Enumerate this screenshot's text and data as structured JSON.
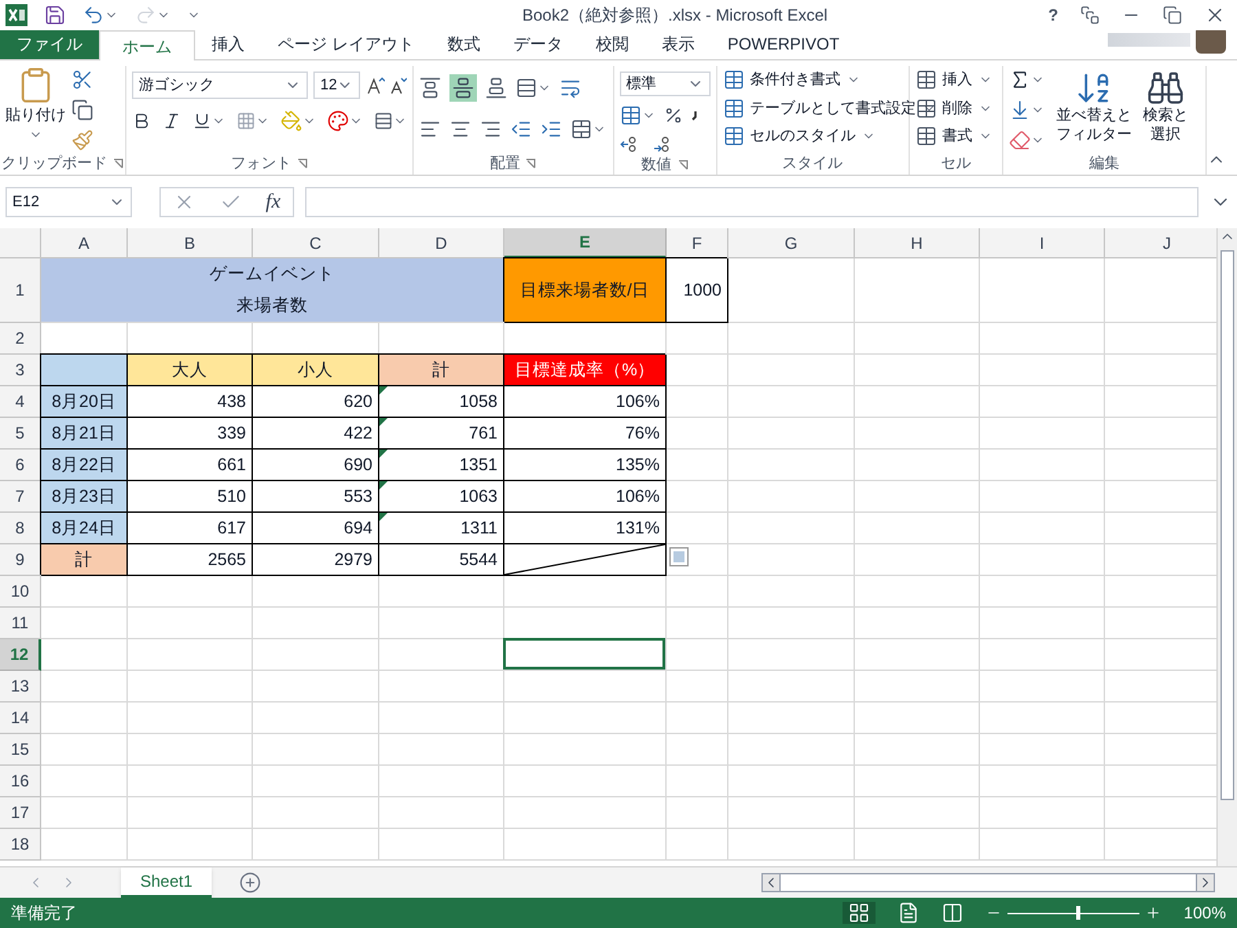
{
  "title_bar": {
    "title": "Book2（絶対参照）.xlsx - Microsoft Excel",
    "help": "?"
  },
  "tabs": [
    {
      "label": "ファイル",
      "kind": "file",
      "selected": false
    },
    {
      "label": "ホーム",
      "kind": "tab",
      "selected": true
    },
    {
      "label": "挿入",
      "kind": "tab",
      "selected": false
    },
    {
      "label": "ページ レイアウト",
      "kind": "tab",
      "selected": false
    },
    {
      "label": "数式",
      "kind": "tab",
      "selected": false
    },
    {
      "label": "データ",
      "kind": "tab",
      "selected": false
    },
    {
      "label": "校閲",
      "kind": "tab",
      "selected": false
    },
    {
      "label": "表示",
      "kind": "tab",
      "selected": false
    },
    {
      "label": "POWERPIVOT",
      "kind": "tab",
      "selected": false
    }
  ],
  "ribbon": {
    "clipboard": {
      "paste": "貼り付け",
      "label": "クリップボード"
    },
    "font": {
      "name": "游ゴシック",
      "size": "12",
      "label": "フォント"
    },
    "alignment": {
      "label": "配置"
    },
    "number": {
      "format": "標準",
      "label": "数値"
    },
    "styles": {
      "items": [
        "条件付き書式",
        "テーブルとして書式設定",
        "セルのスタイル"
      ],
      "label": "スタイル"
    },
    "cells": {
      "items": [
        "挿入",
        "削除",
        "書式"
      ],
      "label": "セル"
    },
    "editing": {
      "sort": [
        "並べ替えと",
        "フィルター"
      ],
      "find": [
        "検索と",
        "選択"
      ],
      "label": "編集"
    }
  },
  "formula_bar": {
    "name_box": "E12",
    "fx": "fx"
  },
  "columns": [
    {
      "label": "A",
      "selected": false
    },
    {
      "label": "B",
      "selected": false
    },
    {
      "label": "C",
      "selected": false
    },
    {
      "label": "D",
      "selected": false
    },
    {
      "label": "E",
      "selected": true
    },
    {
      "label": "F",
      "selected": false
    },
    {
      "label": "G",
      "selected": false
    },
    {
      "label": "H",
      "selected": false
    },
    {
      "label": "I",
      "selected": false
    },
    {
      "label": "J",
      "selected": false
    }
  ],
  "rows": [
    {
      "number": "1",
      "selected": false,
      "cells": [
        {
          "kind": "merged",
          "lines": [
            "ゲームイベント",
            "来場者数"
          ],
          "color": "#b4c6e7"
        },
        {
          "kind": "label",
          "text": "目標来場者数/日",
          "color": "#ff9900",
          "bordered": true
        },
        {
          "kind": "number",
          "text": "1000",
          "bordered": true
        }
      ]
    },
    {
      "number": "2",
      "selected": false,
      "cells": []
    },
    {
      "number": "3",
      "selected": false,
      "cells": [
        {
          "kind": "label",
          "text": "",
          "color": "#bdd7ee",
          "bordered": true
        },
        {
          "kind": "label",
          "text": "大人",
          "color": "#ffe699",
          "bordered": true
        },
        {
          "kind": "label",
          "text": "小人",
          "color": "#ffe699",
          "bordered": true
        },
        {
          "kind": "label",
          "text": "計",
          "color": "#f8cbad",
          "bordered": true
        },
        {
          "kind": "label",
          "text": "目標達成率（%）",
          "color": "#ff0000",
          "bordered": true
        }
      ]
    },
    {
      "number": "4",
      "selected": false,
      "cells": [
        {
          "kind": "label",
          "text": "8月20日",
          "color": "#bdd7ee",
          "bordered": true
        },
        {
          "kind": "number",
          "text": "438",
          "bordered": true
        },
        {
          "kind": "number",
          "text": "620",
          "bordered": true
        },
        {
          "kind": "number",
          "text": "1058",
          "bordered": true,
          "error_marker": true
        },
        {
          "kind": "number",
          "text": "106%",
          "bordered": true
        }
      ]
    },
    {
      "number": "5",
      "selected": false,
      "cells": [
        {
          "kind": "label",
          "text": "8月21日",
          "color": "#bdd7ee",
          "bordered": true
        },
        {
          "kind": "number",
          "text": "339",
          "bordered": true
        },
        {
          "kind": "number",
          "text": "422",
          "bordered": true
        },
        {
          "kind": "number",
          "text": "761",
          "bordered": true,
          "error_marker": true
        },
        {
          "kind": "number",
          "text": "76%",
          "bordered": true
        }
      ]
    },
    {
      "number": "6",
      "selected": false,
      "cells": [
        {
          "kind": "label",
          "text": "8月22日",
          "color": "#bdd7ee",
          "bordered": true
        },
        {
          "kind": "number",
          "text": "661",
          "bordered": true
        },
        {
          "kind": "number",
          "text": "690",
          "bordered": true
        },
        {
          "kind": "number",
          "text": "1351",
          "bordered": true,
          "error_marker": true
        },
        {
          "kind": "number",
          "text": "135%",
          "bordered": true
        }
      ]
    },
    {
      "number": "7",
      "selected": false,
      "cells": [
        {
          "kind": "label",
          "text": "8月23日",
          "color": "#bdd7ee",
          "bordered": true
        },
        {
          "kind": "number",
          "text": "510",
          "bordered": true
        },
        {
          "kind": "number",
          "text": "553",
          "bordered": true
        },
        {
          "kind": "number",
          "text": "1063",
          "bordered": true,
          "error_marker": true
        },
        {
          "kind": "number",
          "text": "106%",
          "bordered": true
        }
      ]
    },
    {
      "number": "8",
      "selected": false,
      "cells": [
        {
          "kind": "label",
          "text": "8月24日",
          "color": "#bdd7ee",
          "bordered": true
        },
        {
          "kind": "number",
          "text": "617",
          "bordered": true
        },
        {
          "kind": "number",
          "text": "694",
          "bordered": true
        },
        {
          "kind": "number",
          "text": "1311",
          "bordered": true,
          "error_marker": true
        },
        {
          "kind": "number",
          "text": "131%",
          "bordered": true
        }
      ]
    },
    {
      "number": "9",
      "selected": false,
      "cells": [
        {
          "kind": "label",
          "text": "計",
          "color": "#f8cbad",
          "bordered": true
        },
        {
          "kind": "number",
          "text": "2565",
          "bordered": true
        },
        {
          "kind": "number",
          "text": "2979",
          "bordered": true
        },
        {
          "kind": "number",
          "text": "5544",
          "bordered": true
        },
        {
          "kind": "diagonal",
          "bordered": true,
          "paste_options": true
        }
      ]
    },
    {
      "number": "10",
      "selected": false,
      "cells": []
    },
    {
      "number": "11",
      "selected": false,
      "cells": []
    },
    {
      "number": "12",
      "selected": true,
      "cells": [
        {
          "kind": "empty"
        },
        {
          "kind": "empty"
        },
        {
          "kind": "empty"
        },
        {
          "kind": "empty"
        },
        {
          "kind": "empty",
          "selected": true
        }
      ]
    },
    {
      "number": "13",
      "selected": false,
      "cells": []
    },
    {
      "number": "14",
      "selected": false,
      "cells": []
    },
    {
      "number": "15",
      "selected": false,
      "cells": []
    },
    {
      "number": "16",
      "selected": false,
      "cells": []
    },
    {
      "number": "17",
      "selected": false,
      "cells": []
    },
    {
      "number": "18",
      "selected": false,
      "cells": []
    }
  ],
  "sheets": [
    {
      "label": "Sheet1",
      "selected": true
    }
  ],
  "status_bar": {
    "status": "準備完了",
    "zoom": "100%",
    "zoom_slider": {
      "level": 0.52
    }
  }
}
